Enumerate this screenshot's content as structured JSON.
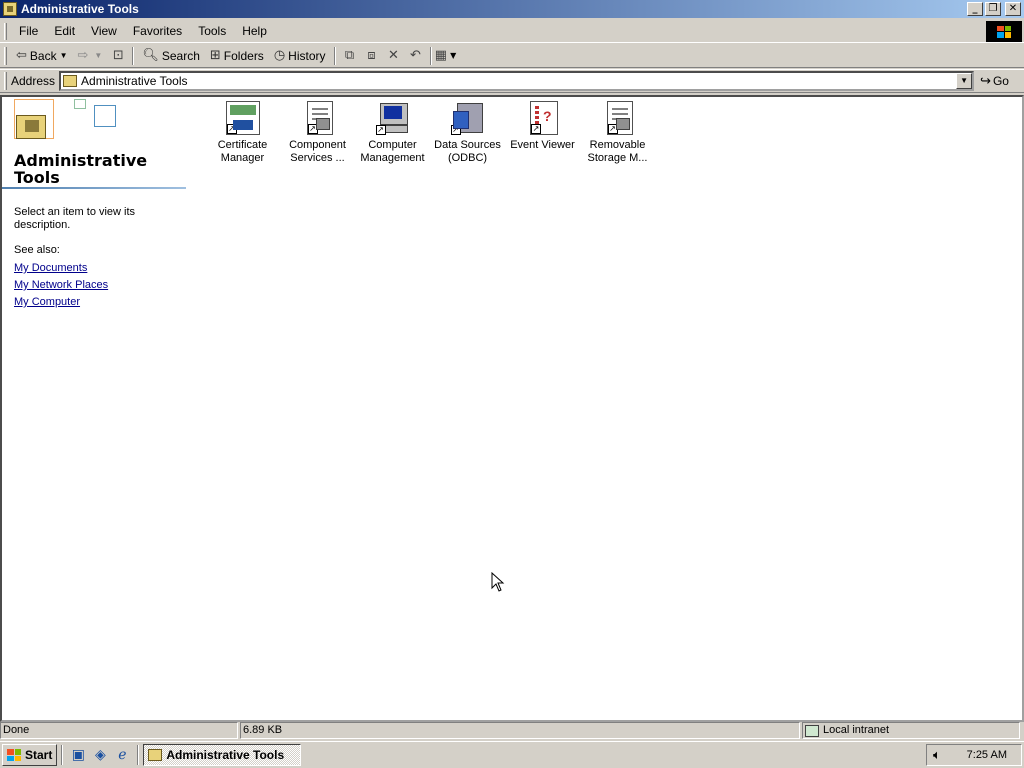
{
  "window": {
    "title": "Administrative Tools",
    "minimize": "_",
    "restore": "❐",
    "close": "✕"
  },
  "menu": [
    "File",
    "Edit",
    "View",
    "Favorites",
    "Tools",
    "Help"
  ],
  "toolbar": {
    "back": "Back",
    "search": "Search",
    "folders": "Folders",
    "history": "History"
  },
  "address": {
    "label": "Address",
    "value": "Administrative Tools",
    "go": "Go"
  },
  "left_pane": {
    "title": "Administrative Tools",
    "description": "Select an item to view its description.",
    "see_also": "See also:",
    "links": [
      "My Documents",
      "My Network Places",
      "My Computer"
    ]
  },
  "icons": [
    {
      "label": "Certificate Manager",
      "icon": "certificate-icon"
    },
    {
      "label": "Component Services ...",
      "icon": "component-services-icon"
    },
    {
      "label": "Computer Management",
      "icon": "computer-management-icon"
    },
    {
      "label": "Data Sources (ODBC)",
      "icon": "odbc-icon"
    },
    {
      "label": "Event Viewer",
      "icon": "event-viewer-icon"
    },
    {
      "label": "Removable Storage M...",
      "icon": "removable-storage-icon"
    }
  ],
  "status": {
    "text": "Done",
    "size": "6.89 KB",
    "zone": "Local intranet"
  },
  "taskbar": {
    "start": "Start",
    "task": "Administrative Tools",
    "clock": "7:25 AM"
  }
}
